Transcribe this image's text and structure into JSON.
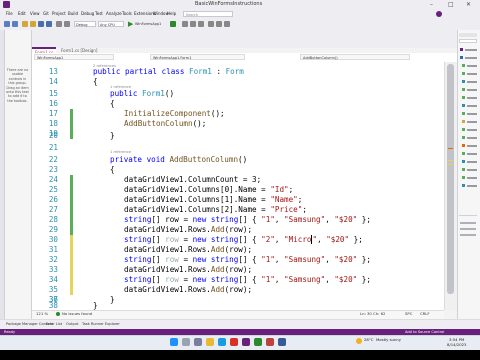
{
  "window": {
    "title": "BasicWinFormsInstructions"
  },
  "menu": [
    "File",
    "Edit",
    "View",
    "Git",
    "Project",
    "Build",
    "Debug",
    "Test",
    "Analyze",
    "Tools",
    "Extensions",
    "Window",
    "Help"
  ],
  "search_placeholder": "Search",
  "toolbar": {
    "config": "Debug",
    "platform": "Any CPU",
    "run_target": "WinFormsApp1"
  },
  "left_panel": {
    "message": "There are no usable controls in this group. Drag an item onto this text to add it to the toolbox."
  },
  "tabs": [
    {
      "label": "Form1.cs",
      "active": true
    },
    {
      "label": "Form1.cs [Design]",
      "active": false
    }
  ],
  "nav": {
    "project": "WinFormsApp1",
    "class": "WinFormsApp1.Form1",
    "member": "AddButtonColumn()"
  },
  "code_lines": [
    {
      "n": "",
      "kind": "ref",
      "text": "2 references"
    },
    {
      "n": "13",
      "kind": "code",
      "id": "l13"
    },
    {
      "n": "14",
      "kind": "code",
      "id": "l14"
    },
    {
      "n": "",
      "kind": "ref",
      "text": "1 reference"
    },
    {
      "n": "15",
      "kind": "code",
      "id": "l15"
    },
    {
      "n": "16",
      "kind": "code",
      "id": "l16"
    },
    {
      "n": "17",
      "kind": "code",
      "id": "l17"
    },
    {
      "n": "18",
      "kind": "code",
      "id": "l18"
    },
    {
      "n": "19",
      "kind": "code",
      "id": "l19"
    },
    {
      "n": "20",
      "kind": "code",
      "id": "l20"
    },
    {
      "n": "21",
      "kind": "code",
      "id": "l21"
    },
    {
      "n": "",
      "kind": "ref",
      "text": "1 reference"
    },
    {
      "n": "22",
      "kind": "code",
      "id": "l22"
    },
    {
      "n": "23",
      "kind": "code",
      "id": "l23"
    },
    {
      "n": "24",
      "kind": "code",
      "id": "l24"
    },
    {
      "n": "25",
      "kind": "code",
      "id": "l25"
    },
    {
      "n": "26",
      "kind": "code",
      "id": "l26"
    },
    {
      "n": "27",
      "kind": "code",
      "id": "l27"
    },
    {
      "n": "28",
      "kind": "code",
      "id": "l28"
    },
    {
      "n": "29",
      "kind": "code",
      "id": "l29"
    },
    {
      "n": "30",
      "kind": "code",
      "id": "l30"
    },
    {
      "n": "31",
      "kind": "code",
      "id": "l31"
    },
    {
      "n": "32",
      "kind": "code",
      "id": "l32"
    },
    {
      "n": "33",
      "kind": "code",
      "id": "l33"
    },
    {
      "n": "34",
      "kind": "code",
      "id": "l34"
    },
    {
      "n": "35",
      "kind": "code",
      "id": "l35"
    },
    {
      "n": "36",
      "kind": "code",
      "id": "l36"
    },
    {
      "n": "37",
      "kind": "code",
      "id": "l37"
    },
    {
      "n": "38",
      "kind": "code",
      "id": "l38"
    }
  ],
  "code": {
    "l13": {
      "a": "public partial class ",
      "b": "Form1",
      "c": " : ",
      "d": "Form"
    },
    "l14": "{",
    "l15": {
      "a": "public ",
      "b": "Form1",
      "c": "()"
    },
    "l16": "{",
    "l17": {
      "a": "InitializeComponent",
      "b": "();"
    },
    "l18": {
      "a": "AddButtonColumn",
      "b": "();"
    },
    "l19": "",
    "l20": "}",
    "l21": "",
    "l22": {
      "a": "private void ",
      "b": "AddButtonColumn",
      "c": "()"
    },
    "l23": "{",
    "l24": "dataGridView1.ColumnCount = 3;",
    "l25": {
      "a": "dataGridView1.Columns[0].Name = ",
      "b": "\"Id\"",
      "c": ";"
    },
    "l26": {
      "a": "dataGridView1.Columns[1].Name = ",
      "b": "\"Name\"",
      "c": ";"
    },
    "l27": {
      "a": "dataGridView1.Columns[2].Name = ",
      "b": "\"Price\"",
      "c": ";"
    },
    "l28": {
      "a": "string",
      "b": "[] row = ",
      "c": "new string",
      "d": "[] { ",
      "e": "\"1\"",
      "f": ", ",
      "g": "\"Samsung\"",
      "h": ", ",
      "i": "\"$20\"",
      "j": " };"
    },
    "l29": {
      "a": "dataGridView1.Rows.",
      "b": "Add",
      "c": "(row);"
    },
    "l30": {
      "a": "string",
      "b": "[] ",
      "r": "row",
      "c": " = ",
      "d": "new string",
      "e": "[] { ",
      "f": "\"2\"",
      "g": ", ",
      "h": "\"Micro",
      "x": "\"",
      "i": ", ",
      "j": "\"$20\"",
      "k": " };"
    },
    "l31": {
      "a": "dataGridView1.Rows.",
      "b": "Add",
      "c": "(row);"
    },
    "l32": {
      "a": "string",
      "b": "[] ",
      "r": "row",
      "c": " = ",
      "d": "new string",
      "e": "[] { ",
      "f": "\"1\"",
      "g": ", ",
      "h": "\"Samsung\"",
      "i": ", ",
      "j": "\"$20\"",
      "k": " };"
    },
    "l33": {
      "a": "dataGridView1.Rows.",
      "b": "Add",
      "c": "(row);"
    },
    "l34": {
      "a": "string",
      "b": "[] ",
      "r": "row",
      "c": " = ",
      "d": "new string",
      "e": "[] { ",
      "f": "\"1\"",
      "g": ", ",
      "h": "\"Samsung\"",
      "i": ", ",
      "j": "\"$20\"",
      "k": " };"
    },
    "l35": {
      "a": "dataGridView1.Rows.",
      "b": "Add",
      "c": "(row);"
    },
    "l36": "",
    "l37": "}",
    "l38": "}"
  },
  "editor_status": {
    "zoom": "121 %",
    "issues": "No issues found",
    "position": "Ln: 30  Ch: 62",
    "encoding": "SPC",
    "eol": "CRLF"
  },
  "output_tabs": [
    "Package Manager Console",
    "Error List",
    "Output",
    "Task Runner Explorer"
  ],
  "vs_status": {
    "left": "Ready",
    "right": "Add to Source Control"
  },
  "taskbar": {
    "weather": "28°C",
    "weather_sub": "Mostly sunny",
    "time": "3:54 PM",
    "date": "8/14/2023"
  },
  "colors": {
    "accent": "#68217a",
    "keyword": "#0000ff",
    "type": "#2b91af",
    "string": "#a31515",
    "change_saved": "#5aad5a",
    "change_unsaved": "#e8d45a"
  }
}
